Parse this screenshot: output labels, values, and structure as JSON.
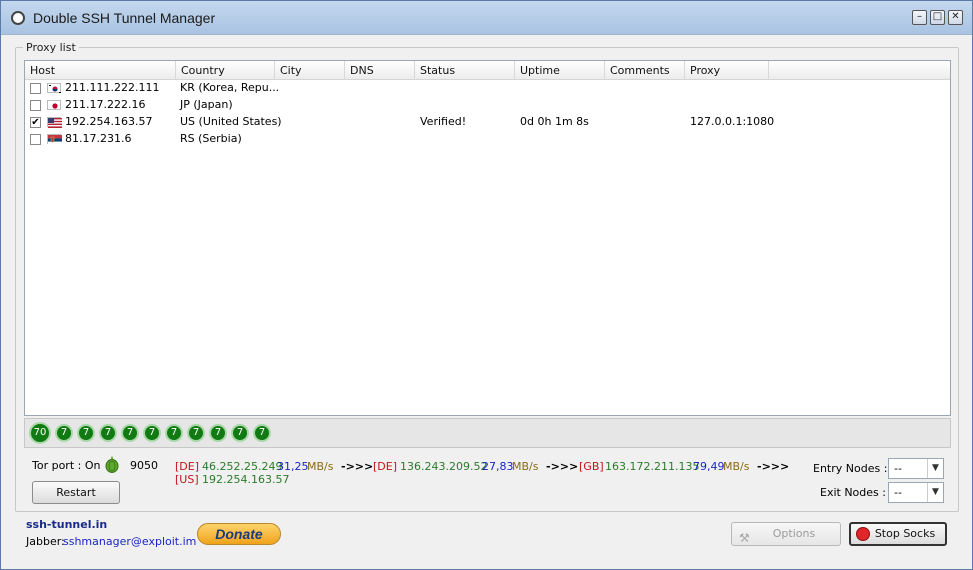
{
  "window": {
    "title": "Double SSH Tunnel Manager",
    "minimize": "–",
    "maximize": "□",
    "close": "✕"
  },
  "proxy_list": {
    "label": "Proxy list",
    "columns": [
      "Host",
      "Country",
      "City",
      "DNS",
      "Status",
      "Uptime",
      "Comments",
      "Proxy"
    ],
    "rows": [
      {
        "checked": "",
        "flag": "KR",
        "host": "211.111.222.111",
        "country": "KR (Korea, Repu...",
        "status": "",
        "uptime": "",
        "proxy": ""
      },
      {
        "checked": "",
        "flag": "JP",
        "host": "211.17.222.16",
        "country": "JP (Japan)",
        "status": "",
        "uptime": "",
        "proxy": ""
      },
      {
        "checked": "✔",
        "flag": "US",
        "host": "192.254.163.57",
        "country": "US (United States)",
        "status": "Verified!",
        "uptime": "0d 0h 1m 8s",
        "proxy": "127.0.0.1:1080"
      },
      {
        "checked": "",
        "flag": "RS",
        "host": "81.17.231.6",
        "country": "RS (Serbia)",
        "status": "",
        "uptime": "",
        "proxy": ""
      }
    ]
  },
  "status_circles": [
    "70",
    "7",
    "7",
    "7",
    "7",
    "7",
    "7",
    "7",
    "7",
    "7",
    "7"
  ],
  "tor": {
    "port_label": "Tor port : On",
    "port_value": "9050",
    "restart_label": "Restart"
  },
  "chain": {
    "hop1_tag": "[DE]",
    "hop1_ip": "46.252.25.249",
    "hop1_speed": "31,25",
    "hop1_unit": "MB/s",
    "hop2_tag": "[DE]",
    "hop2_ip": "136.243.209.52",
    "hop2_speed": "27,83",
    "hop2_unit": "MB/s",
    "hop3_tag": "[GB]",
    "hop3_ip": "163.172.211.135",
    "hop3_speed": "79,49",
    "hop3_unit": "MB/s",
    "arrow": "->>>",
    "exit_tag": "[US]",
    "exit_ip": "192.254.163.57"
  },
  "nodes": {
    "entry_label": "Entry Nodes :",
    "entry_value": "--",
    "exit_label": "Exit Nodes :",
    "exit_value": "--"
  },
  "footer": {
    "site": "ssh-tunnel.in",
    "jabber_label": "Jabber:",
    "jabber_value": "sshmanager@exploit.im",
    "donate_label": "Donate",
    "options_label": "Options",
    "stop_label": "Stop Socks"
  },
  "colors": {
    "circle_green": "#127a12",
    "title_bar": "#a9c3e2",
    "stop_red": "#e0262a"
  }
}
